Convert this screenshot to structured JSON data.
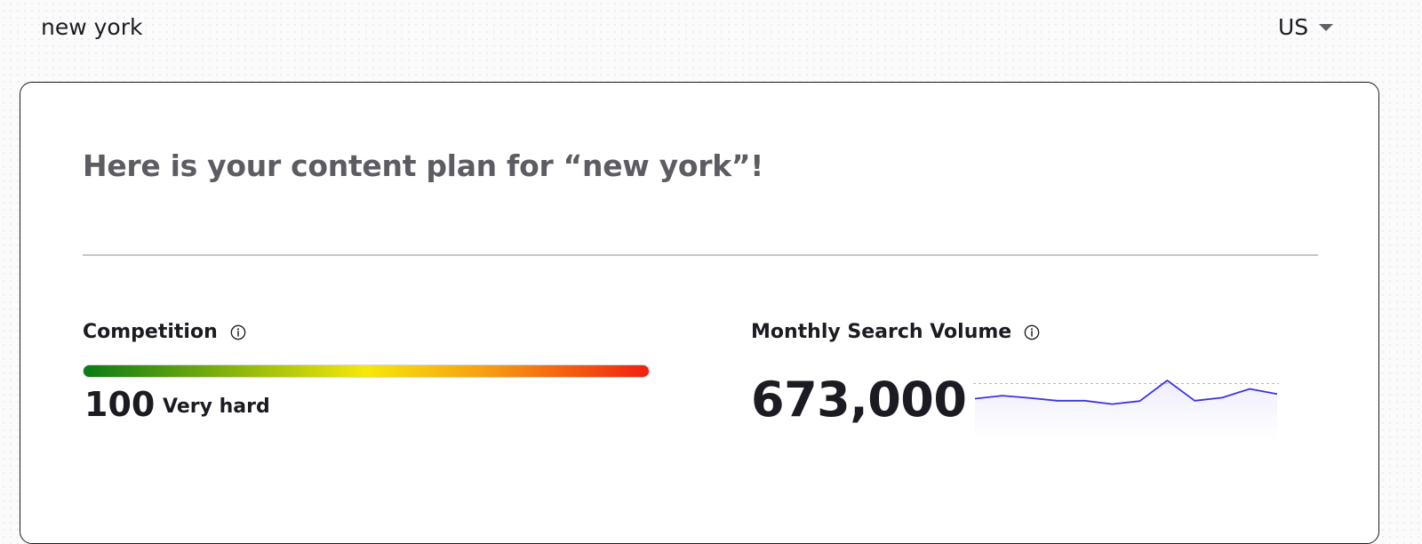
{
  "search": {
    "query": "new york",
    "country": "US"
  },
  "plan": {
    "heading": "Here is your content plan for “new york”!"
  },
  "competition": {
    "label": "Competition",
    "score": "100",
    "level": "Very hard",
    "fraction": 1.0,
    "info_icon": "info-icon"
  },
  "monthly_search_volume": {
    "label": "Monthly Search Volume",
    "value": "673,000",
    "info_icon": "info-icon",
    "trend": [
      0.46,
      0.55,
      0.48,
      0.4,
      0.4,
      0.3,
      0.39,
      1.0,
      0.4,
      0.49,
      0.75,
      0.6
    ]
  },
  "colors": {
    "trend_line": "#3b33e6",
    "trend_fill": "#eeedfd",
    "trend_reference": "#b9b9bf"
  }
}
